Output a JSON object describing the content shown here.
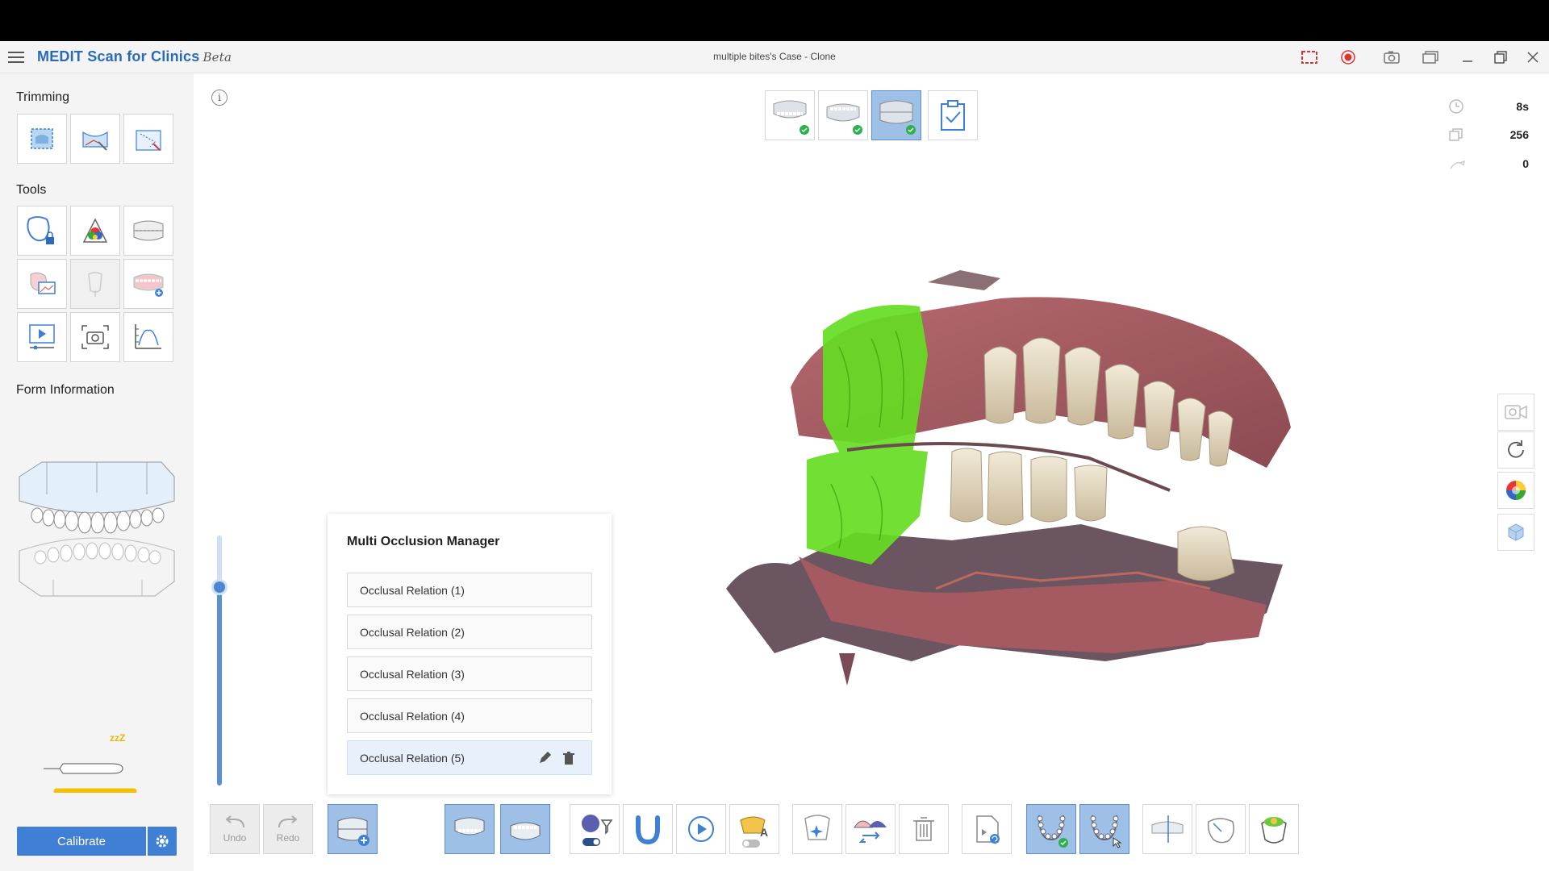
{
  "window": {
    "app_name": "MEDIT Scan for Clinics",
    "app_badge": "Beta",
    "case_title": "multiple bites's Case - Clone"
  },
  "sidebar": {
    "trimming_title": "Trimming",
    "tools_title": "Tools",
    "form_info_title": "Form Information",
    "calibrate_label": "Calibrate"
  },
  "stats": {
    "time": "8s",
    "frames": "256",
    "count": "0"
  },
  "occlusion_manager": {
    "title": "Multi Occlusion Manager",
    "items": [
      "Occlusal Relation (1)",
      "Occlusal Relation (2)",
      "Occlusal Relation (3)",
      "Occlusal Relation (4)",
      "Occlusal Relation (5)"
    ],
    "selected_index": 4
  },
  "bottom_toolbar": {
    "undo_label": "Undo",
    "redo_label": "Redo"
  },
  "colors": {
    "accent": "#3f7fd6",
    "active_tab": "#9ebfe6",
    "scan_green": "#66dd22"
  }
}
